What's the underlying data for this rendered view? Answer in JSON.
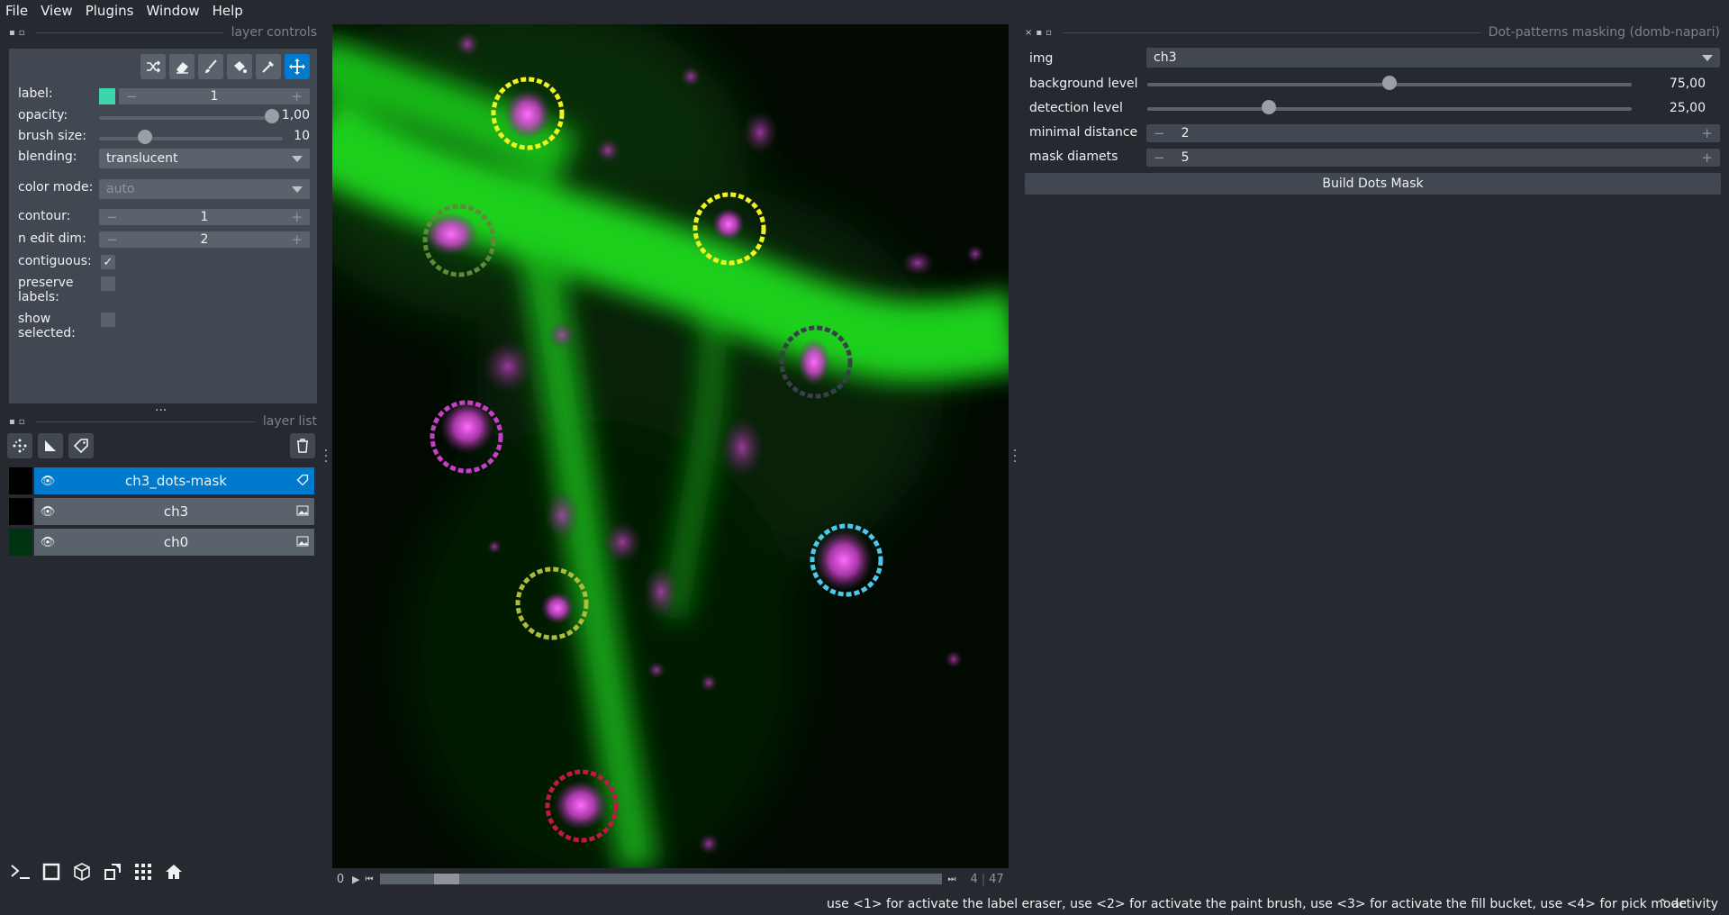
{
  "menu": {
    "file": "File",
    "view": "View",
    "plugins": "Plugins",
    "window": "Window",
    "help": "Help"
  },
  "layer_controls": {
    "title": "layer controls",
    "label_label": "label:",
    "label_value": "1",
    "label_color": "#3dd6a8",
    "opacity_label": "opacity:",
    "opacity_value": "1,00",
    "opacity_fraction": 1.0,
    "brush_label": "brush size:",
    "brush_value": "10",
    "brush_fraction": 0.25,
    "blending_label": "blending:",
    "blending_value": "translucent",
    "colormode_label": "color mode:",
    "colormode_value": "auto",
    "contour_label": "contour:",
    "contour_value": "1",
    "nedit_label": "n edit dim:",
    "nedit_value": "2",
    "contiguous_label": "contiguous:",
    "contiguous_checked": true,
    "preserve_label_1": "preserve",
    "preserve_label_2": "labels:",
    "preserve_checked": false,
    "show_label_1": "show",
    "show_label_2": "selected:",
    "show_checked": false,
    "tools": [
      "shuffle-icon",
      "eraser-icon",
      "brush-icon",
      "fill-bucket-icon",
      "picker-icon",
      "move-icon"
    ]
  },
  "layer_list": {
    "title": "layer list",
    "layers": [
      {
        "name": "ch3_dots-mask",
        "type": "labels",
        "selected": true
      },
      {
        "name": "ch3",
        "type": "image",
        "selected": false
      },
      {
        "name": "ch0",
        "type": "image",
        "selected": false
      }
    ]
  },
  "dims": {
    "current": "0",
    "point": "4",
    "total": "47",
    "slider_fraction": 0.1
  },
  "plugin": {
    "title": "Dot-patterns masking (domb-napari)",
    "img_label": "img",
    "img_value": "ch3",
    "bg_label": "background level",
    "bg_value": "75,00",
    "bg_fraction": 0.5,
    "det_label": "detection level",
    "det_value": "25,00",
    "det_fraction": 0.25,
    "mindist_label": "minimal distance",
    "mindist_value": "2",
    "maskdiam_label": "mask diamets",
    "maskdiam_value": "5",
    "build_label": "Build Dots Mask"
  },
  "status": {
    "message": "use <1> for activate the label eraser, use <2> for activate the paint brush, use <3> for activate the fill bucket, use <4> for pick mode",
    "activity": "activity"
  },
  "colors": {
    "accent": "#007acc",
    "panel": "#414851",
    "bg": "#262930"
  }
}
